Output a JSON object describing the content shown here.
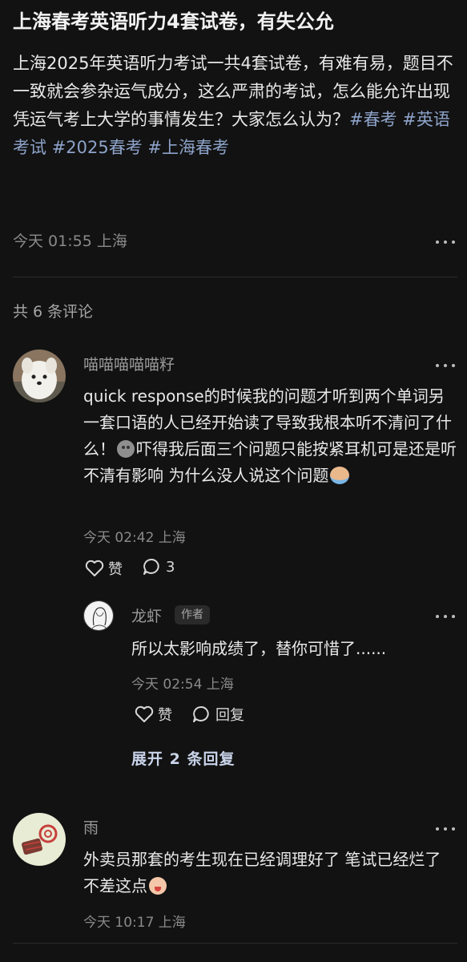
{
  "post": {
    "title": "上海春考英语听力4套试卷，有失公允",
    "body": "上海2025年英语听力考试一共4套试卷，有难有易，题目不一致就会参杂运气成分，这么严肃的考试，怎么能允许出现凭运气考上大学的事情发生？大家怎么认为？",
    "tags": [
      "#春考",
      "#英语考试",
      "#2025春考",
      "#上海春考"
    ],
    "meta": "今天 01:55 上海"
  },
  "comments_header": "共 6 条评论",
  "comments": [
    {
      "username": "喵喵喵喵喵籽",
      "text_part1": "quick response的时候我的问题才听到两个单词另一套口语的人已经开始读了导致我根本听不清问了什么！",
      "text_part2": "吓得我后面三个问题只能按紧耳机可是还是听不清有影响 为什么没人说这个问题",
      "time": "今天 02:42 上海",
      "like_label": "赞",
      "reply_count": "3",
      "replies": [
        {
          "username": "龙虾",
          "badge": "作者",
          "text": "所以太影响成绩了，替你可惜了......",
          "time": "今天 02:54 上海",
          "like_label": "赞",
          "reply_label": "回复"
        }
      ],
      "expand_label": "展开 2 条回复"
    },
    {
      "username": "雨",
      "text": "外卖员那套的考生现在已经调理好了 笔试已经烂了不差这点",
      "time": "今天 10:17 上海"
    }
  ],
  "colors": {
    "background": "#121212",
    "tag": "#8da3c9",
    "expand": "#c9d4ea"
  }
}
